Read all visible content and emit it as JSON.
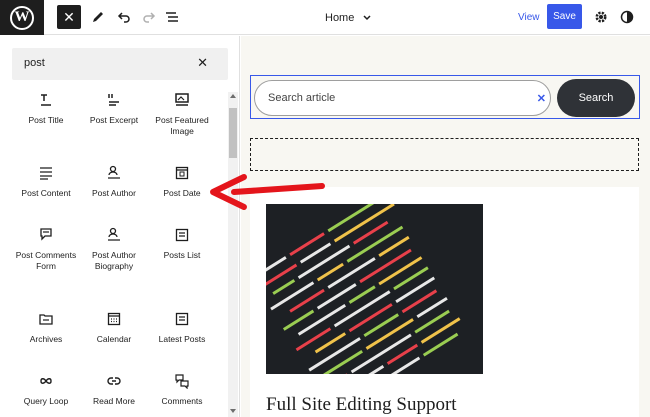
{
  "toolbar": {
    "logo_letter": "W",
    "close_symbol": "✕",
    "document_title": "Home",
    "view_label": "View",
    "save_label": "Save"
  },
  "inserter": {
    "search_value": "post",
    "clear_symbol": "✕",
    "blocks": [
      {
        "label": "Post Title",
        "icon": "post-title-icon"
      },
      {
        "label": "Post Excerpt",
        "icon": "post-excerpt-icon"
      },
      {
        "label": "Post Featured Image",
        "icon": "post-featured-image-icon"
      },
      {
        "label": "Post Content",
        "icon": "post-content-icon"
      },
      {
        "label": "Post Author",
        "icon": "post-author-icon"
      },
      {
        "label": "Post Date",
        "icon": "post-date-icon"
      },
      {
        "label": "Post Comments Form",
        "icon": "post-comments-form-icon"
      },
      {
        "label": "Post Author Biography",
        "icon": "post-author-biography-icon"
      },
      {
        "label": "Posts List",
        "icon": "posts-list-icon"
      },
      {
        "label": "Archives",
        "icon": "archives-icon"
      },
      {
        "label": "Calendar",
        "icon": "calendar-icon"
      },
      {
        "label": "Latest Posts",
        "icon": "latest-posts-icon"
      },
      {
        "label": "Query Loop",
        "icon": "query-loop-icon"
      },
      {
        "label": "Read More",
        "icon": "read-more-icon"
      },
      {
        "label": "Comments",
        "icon": "comments-icon"
      }
    ]
  },
  "canvas": {
    "search_placeholder": "Search article",
    "search_clear": "✕",
    "search_button": "Search",
    "post_title": "Full Site Editing Support"
  },
  "colors": {
    "accent": "#3858e9",
    "annotation": "#e4151b",
    "canvas_bg": "#f8f7f2",
    "dark": "#1e1e1e"
  }
}
